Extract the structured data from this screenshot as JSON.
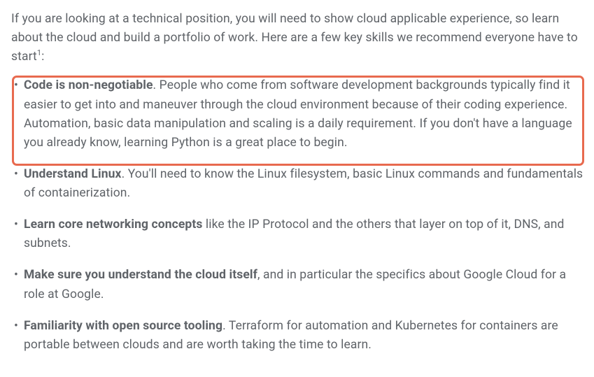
{
  "intro": {
    "text": "If you are looking at a technical position, you will need to show cloud applicable experience, so learn about the cloud and build a portfolio of work. Here are a few key skills we recommend everyone have to start",
    "sup": "1",
    "tail": ":"
  },
  "skills": [
    {
      "bold": "Code is non-negotiable",
      "rest": ". People who come from software development backgrounds typically find it easier to get into and maneuver through the cloud environment because of their coding experience. Automation, basic data manipulation and scaling is a daily requirement. If you don't have a language you already know, learning Python is a great place to begin."
    },
    {
      "bold": "Understand Linux",
      "rest": ". You'll need to know the Linux filesystem, basic Linux commands and fundamentals of containerization."
    },
    {
      "bold": "Learn core networking concepts",
      "rest": " like the IP Protocol and the others that layer on top of it, DNS, and subnets."
    },
    {
      "bold": "Make sure you understand the cloud itself",
      "rest": ", and in particular the specifics about Google Cloud for a role at Google."
    },
    {
      "bold": "Familiarity with open source tooling",
      "rest": ". Terraform for automation and Kubernetes for containers are portable between clouds and are worth taking the time to learn."
    }
  ]
}
